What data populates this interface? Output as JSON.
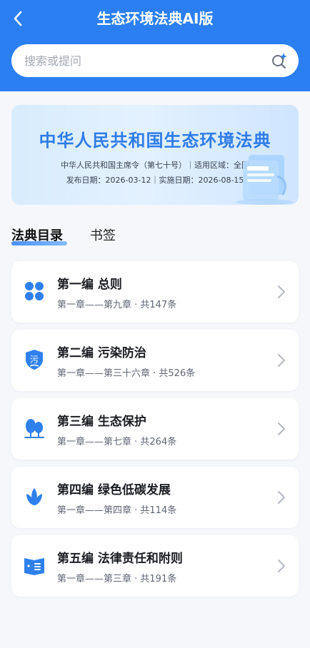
{
  "header": {
    "title": "生态环境法典AI版",
    "back_icon": "back-arrow-icon",
    "background": "#2b7ff3"
  },
  "search": {
    "placeholder": "搜索或提问",
    "icon": "ai-search-icon"
  },
  "banner": {
    "title": "中华人民共和国生态环境法典",
    "line1": "中华人民共和国主席令（第七十号）｜适用区域：全国",
    "line2": "发布日期：2026-03-12｜实施日期：2026-08-15"
  },
  "tabs": [
    {
      "label": "法典目录",
      "active": true
    },
    {
      "label": "书签",
      "active": false
    }
  ],
  "volumes": [
    {
      "name": "第一编 总则",
      "sub": "第一章——第九章 · 共147条",
      "icon": "clover-icon"
    },
    {
      "name": "第二编 污染防治",
      "sub": "第一章——第三十六章 · 共526条",
      "icon": "pollution-shield-icon"
    },
    {
      "name": "第三编 生态保护",
      "sub": "第一章——第七章 · 共264条",
      "icon": "trees-icon"
    },
    {
      "name": "第四编 绿色低碳发展",
      "sub": "第一章——第四章 · 共114条",
      "icon": "leaf-icon"
    },
    {
      "name": "第五编 法律责任和附则",
      "sub": "第一章——第三章 · 共191条",
      "icon": "book-icon"
    }
  ],
  "colors": {
    "accent": "#2b7ff3",
    "icon_blue": "#2f80ed"
  }
}
